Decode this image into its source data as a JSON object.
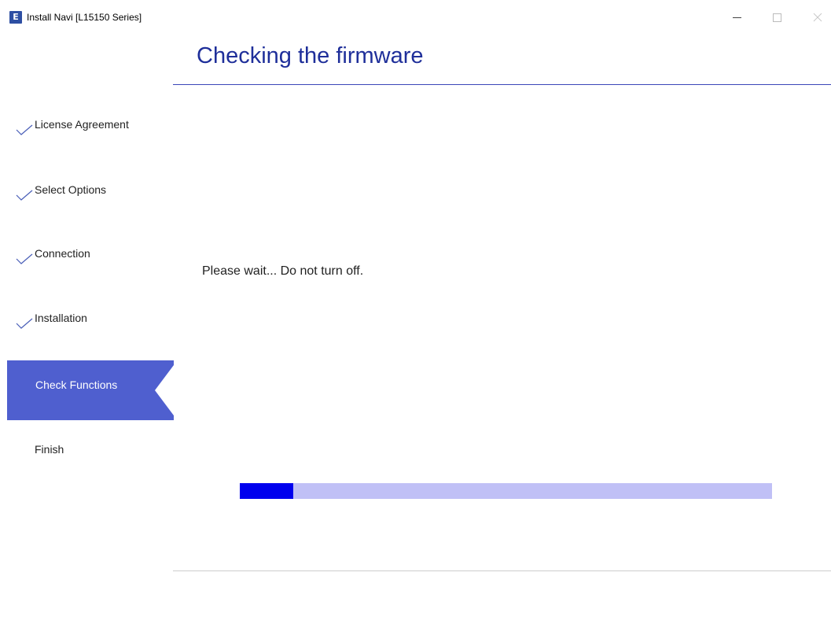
{
  "window": {
    "app_icon_letter": "E",
    "title": "Install Navi [L15150 Series]"
  },
  "header": {
    "title": "Checking the firmware"
  },
  "sidebar": {
    "steps": [
      {
        "label": "License Agreement",
        "state": "done"
      },
      {
        "label": "Select Options",
        "state": "done"
      },
      {
        "label": "Connection",
        "state": "done"
      },
      {
        "label": "Installation",
        "state": "done"
      },
      {
        "label": "Check Functions",
        "state": "active"
      },
      {
        "label": "Finish",
        "state": "pending"
      }
    ]
  },
  "main": {
    "message": "Please wait... Do not turn off.",
    "progress_fraction": 0.1
  },
  "colors": {
    "accent": "#1f2f9a",
    "active_step_bg": "#4f5fcf",
    "progress_fill": "#0000ee",
    "progress_track": "#c0c0f6"
  }
}
